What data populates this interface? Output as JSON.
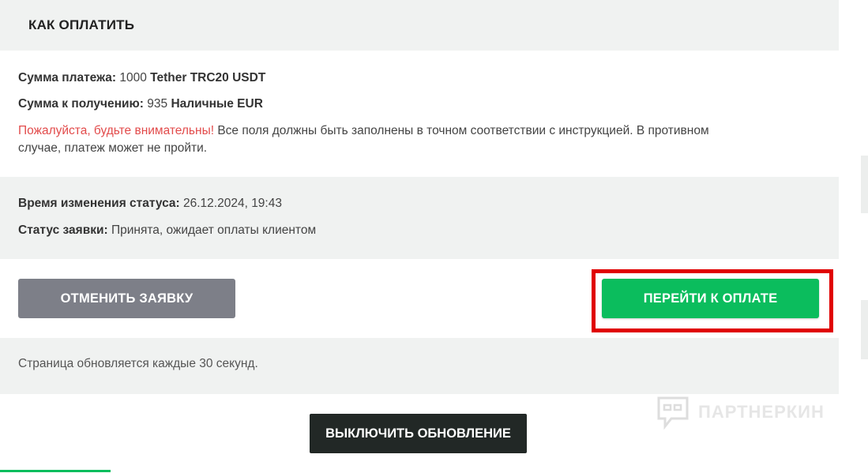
{
  "header": {
    "title": "КАК ОПЛАТИТЬ"
  },
  "payment": {
    "amount_label": "Сумма платежа:",
    "amount_value": "1000",
    "amount_currency": "Tether TRC20 USDT",
    "receive_label": "Сумма к получению:",
    "receive_value": "935",
    "receive_currency": "Наличные EUR",
    "warning_highlight": "Пожалуйста, будьте внимательны!",
    "warning_text_1": " Все поля должны быть заполнены в точном соответствии с инструкцией. В противном",
    "warning_text_2": "случае, платеж может не пройти."
  },
  "status": {
    "changed_label": "Время изменения статуса:",
    "changed_value": "26.12.2024, 19:43",
    "order_label": "Статус заявки:",
    "order_value": "Принята, ожидает оплаты клиентом"
  },
  "actions": {
    "cancel_label": "ОТМЕНИТЬ ЗАЯВКУ",
    "pay_label": "ПЕРЕЙТИ К ОПЛАТЕ"
  },
  "refresh": {
    "note": "Страница обновляется каждые 30 секунд.",
    "toggle_label": "ВЫКЛЮЧИТЬ ОБНОВЛЕНИЕ"
  },
  "watermark": {
    "text": "ПАРТНЕРКИН",
    "icon": "chat-bubble-icon"
  },
  "colors": {
    "accent_green": "#0bbd5d",
    "cancel_gray": "#7d7f88",
    "warning_red": "#e24b4b",
    "highlight_red": "#e00000",
    "panel_bg": "#f0f2f1",
    "dark_button": "#222826"
  }
}
